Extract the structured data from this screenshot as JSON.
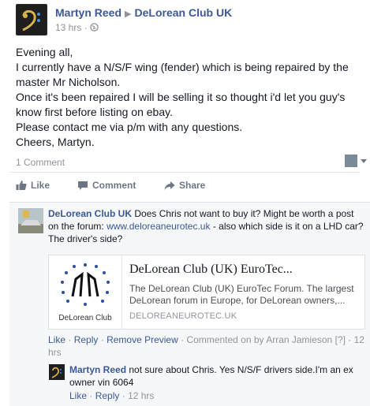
{
  "post": {
    "author": "Martyn Reed",
    "group": "DeLorean Club UK",
    "time": "13 hrs",
    "audience_icon": "globe-icon",
    "body_lines": [
      "Evening all,",
      "I currently have a N/S/F wing (fender) which is being repaired by the master Mr Nicholson.",
      "Once it's been repaired I will be selling it so thought i'd let you guy's know first before listing on ebay.",
      "Please contact me via p/m with any questions.",
      "Cheers, Martyn."
    ],
    "comment_count": "1 Comment"
  },
  "actions": {
    "like": "Like",
    "comment": "Comment",
    "share": "Share"
  },
  "comments": [
    {
      "author": "DeLorean Club UK",
      "text_before_link": "Does Chris not want to buy it? Might be worth a post on the forum:",
      "link": "www.deloreaneurotec.uk",
      "text_after_link": "- also which side is it on a LHD car? The driver's side?",
      "card": {
        "title": "DeLorean Club (UK) EuroTec...",
        "description": "The DeLorean Club (UK) EuroTec Forum. The largest DeLorean forum in Europe, for DeLorean owners,...",
        "domain": "DELOREANEUROTEC.UK",
        "logo_text": "DeLorean Club"
      },
      "meta": {
        "like": "Like",
        "reply": "Reply",
        "remove_preview": "Remove Preview",
        "commented_on_by": "Commented on by Arran Jamieson",
        "bracket": "[?]",
        "time": "12 hrs"
      }
    },
    {
      "author": "Martyn Reed",
      "text": "not sure about Chris. Yes N/S/F drivers side.I'm an ex owner vin 6064",
      "meta": {
        "like": "Like",
        "reply": "Reply",
        "time": "12 hrs"
      }
    }
  ],
  "colors": {
    "link": "#3b5998",
    "muted": "#90949c",
    "comment_bg": "#f6f7f9"
  }
}
